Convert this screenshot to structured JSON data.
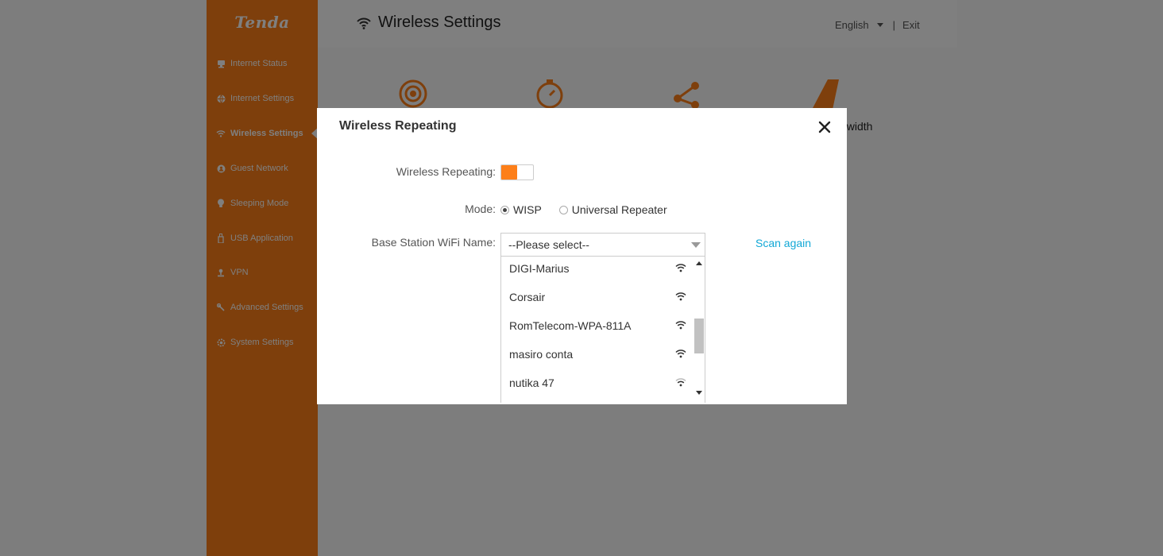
{
  "brand": {
    "logo": "Tenda",
    "accent_color": "#fd7f19",
    "link_color": "#12a8d6"
  },
  "header": {
    "title": "Wireless Settings",
    "title_icon": "wifi-icon",
    "language": "English",
    "separator": "|",
    "exit": "Exit"
  },
  "sidebar": {
    "items": [
      {
        "label": "Internet Status",
        "icon": "computer-icon"
      },
      {
        "label": "Internet Settings",
        "icon": "globe-icon"
      },
      {
        "label": "Wireless Settings",
        "icon": "wifi-icon",
        "active": true
      },
      {
        "label": "Guest Network",
        "icon": "guest-icon"
      },
      {
        "label": "Sleeping Mode",
        "icon": "bulb-icon"
      },
      {
        "label": "USB Application",
        "icon": "usb-icon"
      },
      {
        "label": "VPN",
        "icon": "vpn-icon"
      },
      {
        "label": "Advanced Settings",
        "icon": "wrench-icon"
      },
      {
        "label": "System Settings",
        "icon": "gear-icon"
      }
    ]
  },
  "background": {
    "features": [
      "signal-icon",
      "stopwatch-icon",
      "share-icon",
      "road-icon"
    ],
    "partial_text": "dwidth"
  },
  "modal": {
    "title": "Wireless Repeating",
    "close_icon": "close-icon",
    "repeating_label": "Wireless Repeating:",
    "repeating_enabled": true,
    "mode_label": "Mode:",
    "modes": [
      {
        "label": "WISP",
        "checked": true
      },
      {
        "label": "Universal Repeater",
        "checked": false
      }
    ],
    "base_station_label": "Base Station WiFi Name:",
    "select_value": "--Please select--",
    "scan_again": "Scan again",
    "networks": [
      {
        "name": "DIGI-Marius",
        "signal": "strong"
      },
      {
        "name": "Corsair",
        "signal": "strong"
      },
      {
        "name": "RomTelecom-WPA-811A",
        "signal": "strong"
      },
      {
        "name": "masiro conta",
        "signal": "strong"
      },
      {
        "name": "nutika 47",
        "signal": "weak"
      }
    ]
  }
}
